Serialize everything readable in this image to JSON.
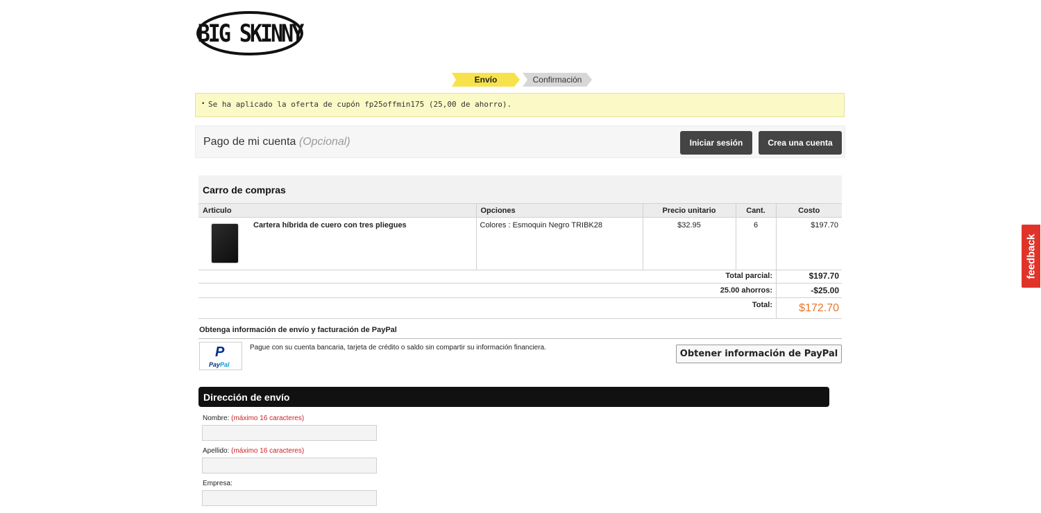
{
  "brand": {
    "logo_text": "BIG SKINNY"
  },
  "steps": {
    "active": "Envío",
    "inactive": "Confirmación"
  },
  "notice": {
    "text": "Se ha aplicado la oferta de cupón fp25offmin175 (25,00 de ahorro)."
  },
  "account": {
    "title": "Pago de mi cuenta",
    "optional": "(Opcional)",
    "login_label": "Iniciar sesión",
    "create_label": "Crea una cuenta"
  },
  "cart": {
    "title": "Carro de compras",
    "columns": [
      "Articulo",
      "Opciones",
      "Precio unitario",
      "Cant.",
      "Costo"
    ],
    "items": [
      {
        "name": "Cartera híbrida de cuero con tres pliegues",
        "options": "Colores : Esmoquin Negro TRIBK28",
        "unit_price": "$32.95",
        "qty": "6",
        "cost": "$197.70"
      }
    ],
    "subtotal_label": "Total parcial:",
    "subtotal": "$197.70",
    "savings_label": "25.00 ahorros:",
    "savings": "-$25.00",
    "total_label": "Total:",
    "total": "$172.70",
    "colors": {
      "total": "#e8752a"
    }
  },
  "paypal": {
    "section_title": "Obtenga información de envío y facturación de PayPal",
    "logo_mark": "P",
    "logo_word_a": "Pay",
    "logo_word_b": "Pal",
    "description": "Pague con su cuenta bancaria, tarjeta de crédito o saldo sin compartir su información financiera.",
    "button_label": "Obtener información de PayPal"
  },
  "shipping": {
    "title": "Dirección de envío",
    "fields": [
      {
        "label": "Nombre:",
        "hint": "(máximo 16 caracteres)",
        "value": ""
      },
      {
        "label": "Apellido:",
        "hint": "(máximo 16 caracteres)",
        "value": ""
      },
      {
        "label": "Empresa:",
        "hint": "",
        "value": ""
      }
    ]
  },
  "feedback": {
    "label": "feedback",
    "color": "#e0342a"
  }
}
